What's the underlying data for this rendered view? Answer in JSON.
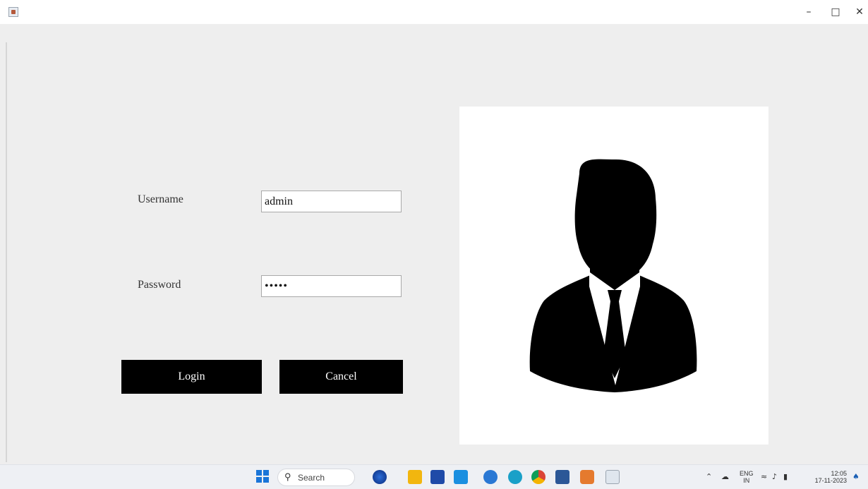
{
  "window": {
    "minimize_glyph": "–",
    "maximize_glyph": "□",
    "close_glyph": "✕"
  },
  "form": {
    "username_label": "Username",
    "username_value": "admin",
    "password_label": "Password",
    "password_value": "•••••",
    "login_label": "Login",
    "cancel_label": "Cancel"
  },
  "taskbar": {
    "search_placeholder": "Search",
    "language": "ENG",
    "region": "IN",
    "time": "12:05",
    "date": "17-11-2023",
    "apps": [
      "copilot-icon",
      "file-explorer-icon",
      "store-icon",
      "mail-icon",
      "edge-beta-icon",
      "edge-icon",
      "chrome-icon",
      "word-icon",
      "app-icon",
      "java-icon"
    ]
  },
  "colors": {
    "background": "#eeeeee",
    "button": "#000000",
    "button_text": "#ffffff"
  }
}
